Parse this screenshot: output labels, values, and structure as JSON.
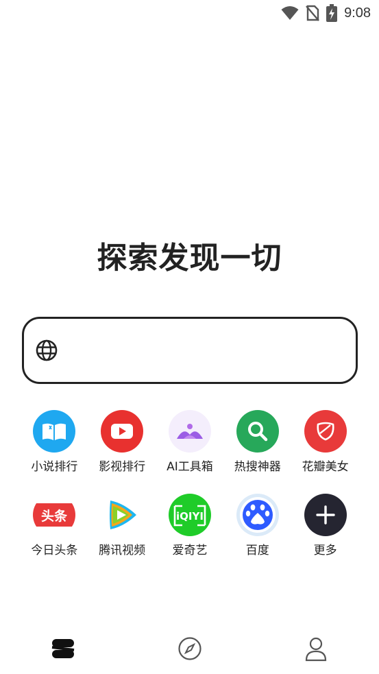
{
  "status_bar": {
    "time": "9:08"
  },
  "main": {
    "headline": "探索发现一切"
  },
  "search": {
    "value": "",
    "placeholder": ""
  },
  "apps": [
    {
      "label": "小说排行",
      "icon": "book-icon",
      "color": "#1fa8f0"
    },
    {
      "label": "影视排行",
      "icon": "play-icon",
      "color": "#e8312f"
    },
    {
      "label": "AI工具箱",
      "icon": "ai-icon",
      "color": "#9b5de5"
    },
    {
      "label": "热搜神器",
      "icon": "search-icon",
      "color": "#27a85a"
    },
    {
      "label": "花瓣美女",
      "icon": "petal-icon",
      "color": "#e83a3a"
    },
    {
      "label": "今日头条",
      "icon": "toutiao-logo",
      "text": "头条",
      "color": "#e83a3a"
    },
    {
      "label": "腾讯视频",
      "icon": "tencent-video-logo",
      "color": "#1fb7f0"
    },
    {
      "label": "爱奇艺",
      "icon": "iqiyi-logo",
      "text": "iQIYI",
      "color": "#1fcc29"
    },
    {
      "label": "百度",
      "icon": "baidu-paw-logo",
      "color": "#2e5bff"
    },
    {
      "label": "更多",
      "icon": "plus-icon",
      "color": "#252531"
    }
  ],
  "bottom_nav": [
    {
      "name": "home",
      "icon": "home-logo-icon"
    },
    {
      "name": "discover",
      "icon": "compass-icon"
    },
    {
      "name": "profile",
      "icon": "person-icon"
    }
  ]
}
